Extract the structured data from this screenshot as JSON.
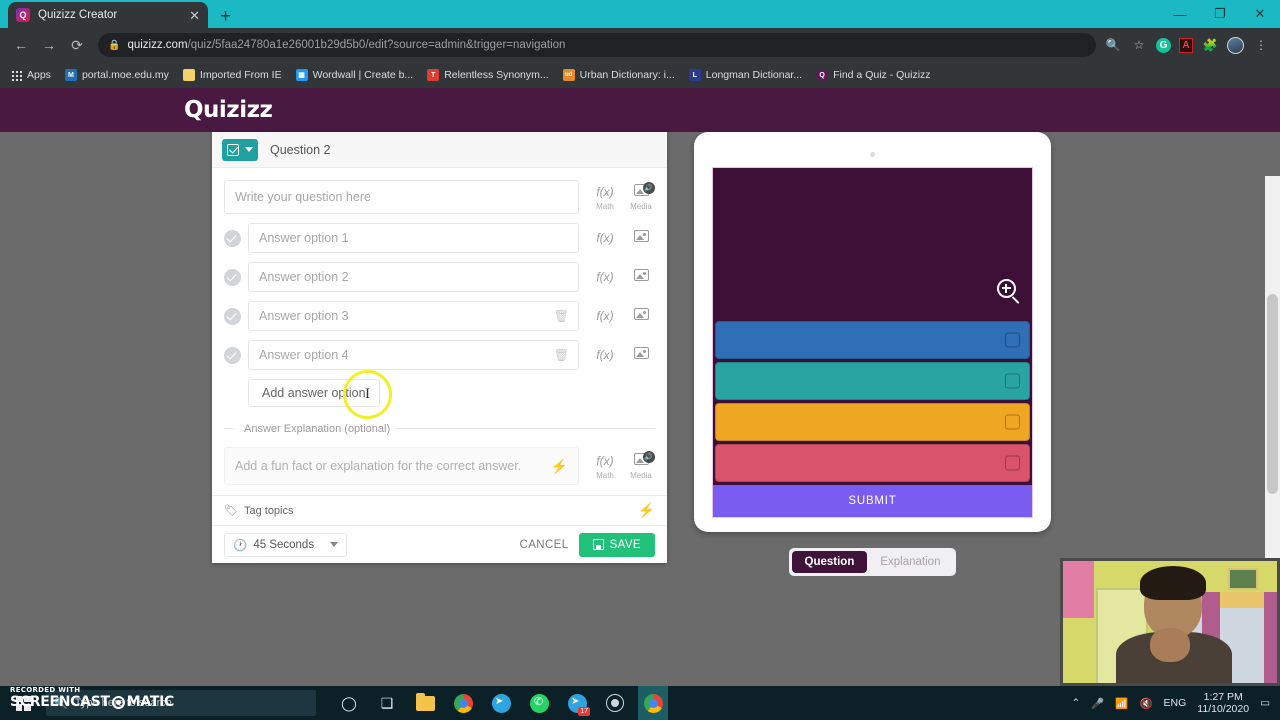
{
  "browser": {
    "tab": {
      "title": "Quizizz Creator",
      "favicon": "Q",
      "close_label": "✕"
    },
    "new_tab_label": "+",
    "window_controls": {
      "minimize": "—",
      "maximize": "❐",
      "close": "✕"
    },
    "nav": {
      "back": "←",
      "forward": "→",
      "reload": "⟳"
    },
    "url": {
      "lock_icon": "lock-icon",
      "host": "quizizz.com",
      "path": "/quiz/5faa24780a1e26001b29d5b0/edit?source=admin&trigger=navigation"
    },
    "toolbar_icons": [
      "search-icon",
      "bookmark-star-icon",
      "grammarly-extension",
      "adobe-acrobat-extension",
      "extensions-puzzle-icon",
      "profile-avatar",
      "chrome-menu-icon"
    ],
    "bookmarks": [
      {
        "label": "Apps",
        "icon": "apps-grid-icon",
        "color": ""
      },
      {
        "label": "portal.moe.edu.my",
        "icon": "moe-icon",
        "color": "#1f6fb2"
      },
      {
        "label": "Imported From IE",
        "icon": "folder-icon",
        "color": "#f3d26b"
      },
      {
        "label": "Wordwall | Create b...",
        "icon": "wordwall-icon",
        "color": "#2196f3"
      },
      {
        "label": "Relentless Synonym...",
        "icon": "thesaurus-icon",
        "color": "#e03c31"
      },
      {
        "label": "Urban Dictionary: i...",
        "icon": "urban-dictionary-icon",
        "color": "#e8892b",
        "badge": "ud"
      },
      {
        "label": "Longman Dictionar...",
        "icon": "longman-icon",
        "color": "#2b3a8f"
      },
      {
        "label": "Find a Quiz - Quizizz",
        "icon": "quizizz-icon",
        "color": "#5c1a58",
        "badge": "Q"
      }
    ]
  },
  "app": {
    "logo": "Quizizz",
    "brand_color": "#4a1942"
  },
  "editor": {
    "question_type_icon": "checkbox-icon",
    "dropdown_icon": "chevron-down-icon",
    "title": "Question 2",
    "question_placeholder": "Write your question here",
    "tool_math_icon": "f(x)",
    "tool_math_label": "Math",
    "tool_media_icon": "media-icon",
    "tool_media_label": "Media",
    "options": [
      {
        "placeholder": "Answer option 1",
        "has_delete": false
      },
      {
        "placeholder": "Answer option 2",
        "has_delete": false
      },
      {
        "placeholder": "Answer option 3",
        "has_delete": true
      },
      {
        "placeholder": "Answer option 4",
        "has_delete": true
      }
    ],
    "delete_icon": "trash-icon",
    "add_option_label": "Add answer option",
    "explanation_legend": "Answer Explanation (optional)",
    "explanation_placeholder": "Add a fun fact or explanation for the correct answer.",
    "bolt_icon": "lightning-bolt-icon",
    "tag_topics_label": "Tag topics",
    "tag_icon": "tag-icon",
    "timer_value": "45 Seconds",
    "timer_icon": "clock-icon",
    "cancel_label": "CANCEL",
    "save_label": "SAVE",
    "save_icon": "floppy-disk-icon",
    "save_color": "#21c179"
  },
  "preview": {
    "camera_dot": "camera-dot",
    "question_area_color": "#3d0f37",
    "magnify_icon": "magnify-plus-icon",
    "answers": [
      {
        "color": "#2f6fb5",
        "index": 1
      },
      {
        "color": "#2aa3a3",
        "index": 2
      },
      {
        "color": "#efa723",
        "index": 3
      },
      {
        "color": "#d9536b",
        "index": 4
      }
    ],
    "submit_label": "SUBMIT",
    "submit_color": "#7b5cf0",
    "tabs": [
      {
        "label": "Question",
        "active": true
      },
      {
        "label": "Explanation",
        "active": false
      }
    ]
  },
  "taskbar": {
    "search_placeholder": "Type here to search",
    "search_icon": "search-icon",
    "start_icon": "windows-logo",
    "apps": [
      {
        "name": "cortana-icon",
        "glyph": "◯"
      },
      {
        "name": "task-view-icon",
        "glyph": "❑|"
      },
      {
        "name": "file-explorer-icon",
        "glyph": ""
      },
      {
        "name": "chrome-icon",
        "glyph": ""
      },
      {
        "name": "telegram-icon",
        "glyph": ""
      },
      {
        "name": "whatsapp-icon",
        "glyph": ""
      },
      {
        "name": "telegram-2-icon",
        "glyph": "",
        "badge": "17"
      },
      {
        "name": "screen-recorder-icon",
        "glyph": ""
      },
      {
        "name": "chrome-active-icon",
        "glyph": ""
      }
    ],
    "tray": {
      "chevron": "⌃",
      "mic_icon": "microphone-icon",
      "wifi_icon": "wifi-icon",
      "volume_icon": "volume-muted-icon",
      "language": "ENG",
      "time": "1:27 PM",
      "date": "11/10/2020",
      "notifications_icon": "notification-icon"
    }
  },
  "watermark": {
    "top_line": "RECORDED WITH",
    "main_line_1": "SCREENCAST",
    "main_line_2": "MATIC"
  }
}
